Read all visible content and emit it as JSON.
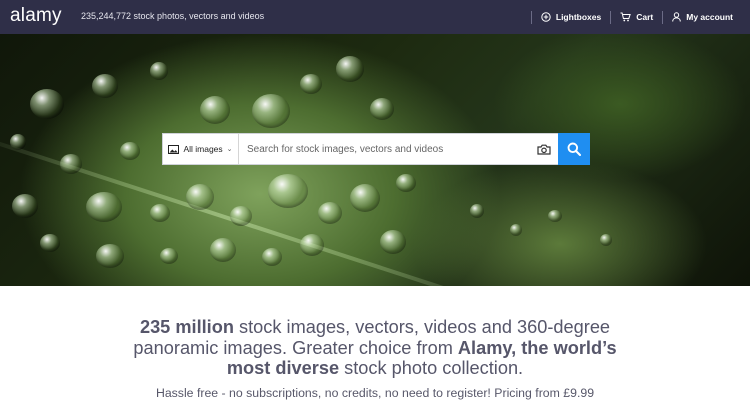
{
  "header": {
    "logo": "alamy",
    "tagline": "235,244,772 stock photos, vectors and videos",
    "nav": [
      {
        "label": "Lightboxes",
        "icon": "plus-circle-icon"
      },
      {
        "label": "Cart",
        "icon": "cart-icon"
      },
      {
        "label": "My account",
        "icon": "user-icon"
      }
    ]
  },
  "search": {
    "type_label": "All images",
    "placeholder": "Search for stock images, vectors and videos",
    "value": ""
  },
  "intro": {
    "part1_bold": "235 million",
    "part1": " stock images, vectors, videos and 360-degree panoramic images. Greater choice from ",
    "part2_bold": "Alamy, the world’s most diverse",
    "part2": " stock photo collection.",
    "subline": "Hassle free - no subscriptions, no credits, no need to register! Pricing from £9.99"
  },
  "colors": {
    "header_bg": "#2f2f48",
    "search_button": "#1f8ef1",
    "text": "#56566a"
  }
}
